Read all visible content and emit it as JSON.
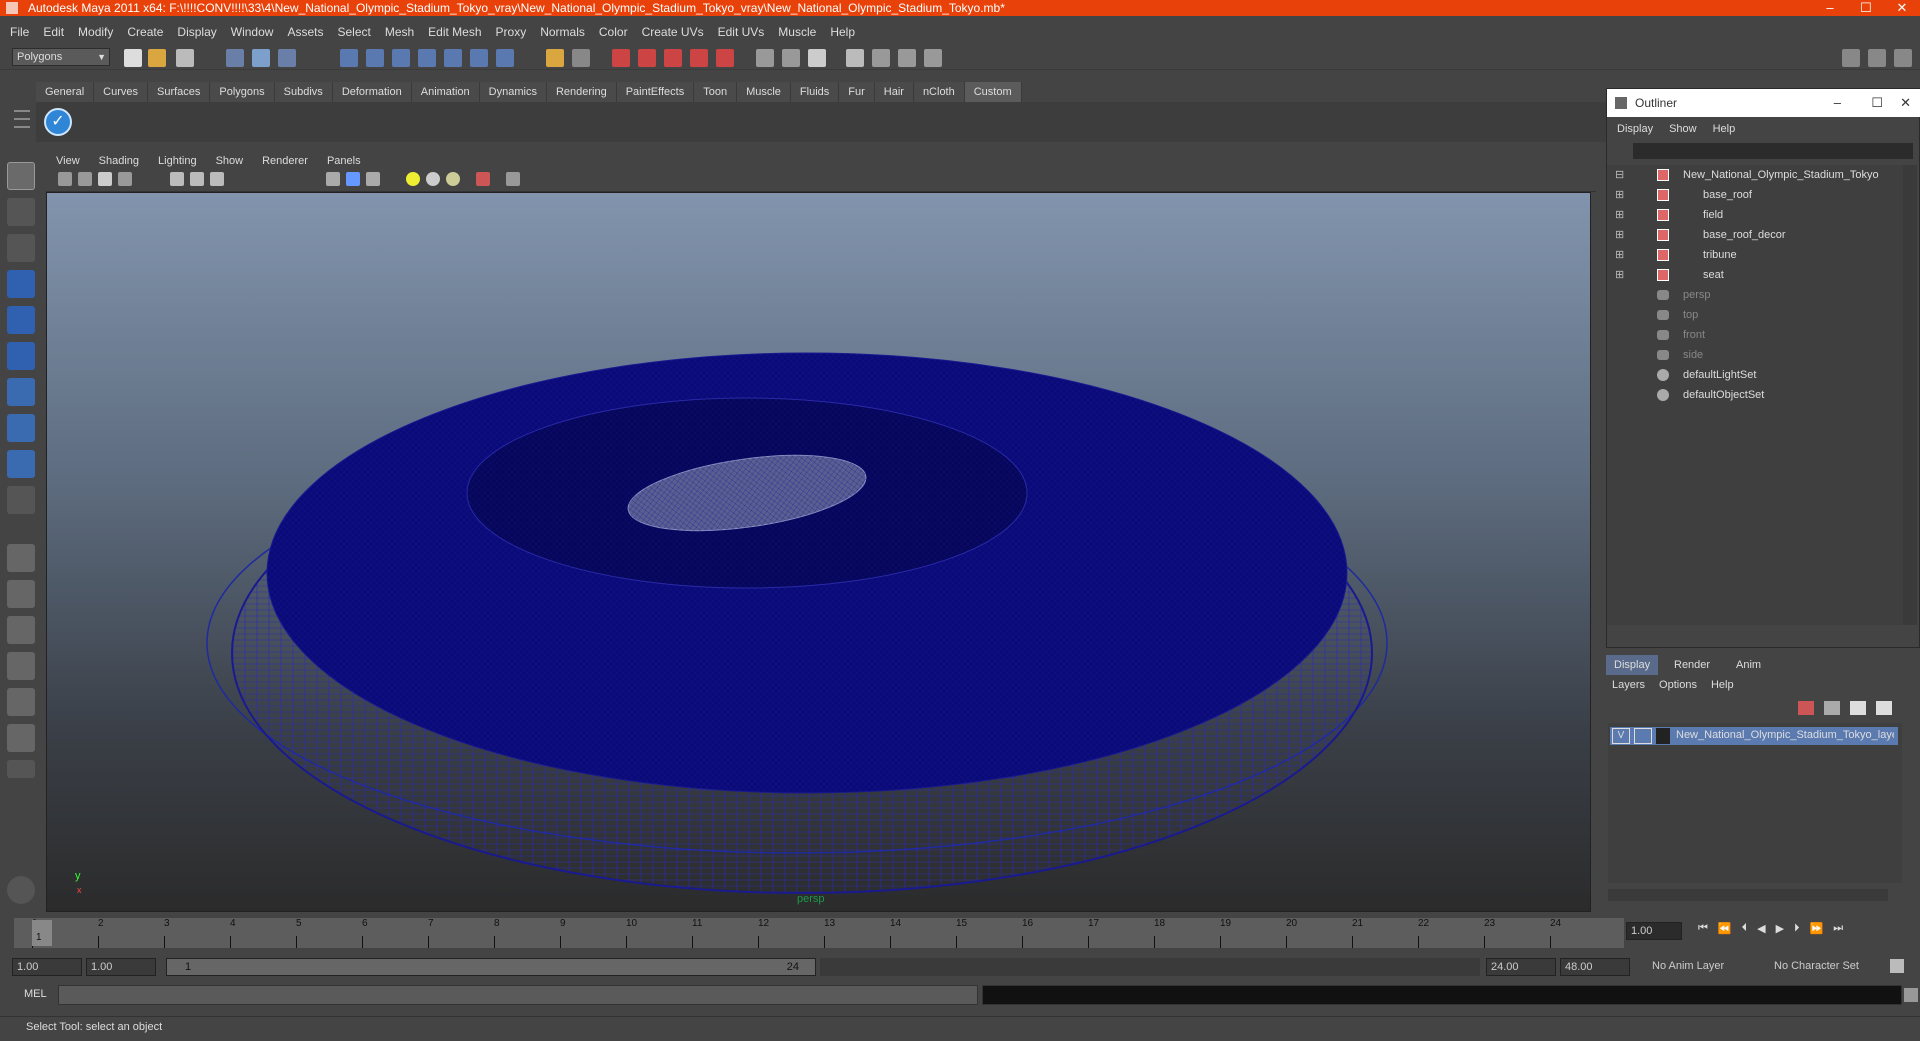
{
  "window": {
    "title": "Autodesk Maya 2011 x64: F:\\!!!!CONV!!!!\\33\\4\\New_National_Olympic_Stadium_Tokyo_vray\\New_National_Olympic_Stadium_Tokyo_vray\\New_National_Olympic_Stadium_Tokyo.mb*"
  },
  "menu": [
    "File",
    "Edit",
    "Modify",
    "Create",
    "Display",
    "Window",
    "Assets",
    "Select",
    "Mesh",
    "Edit Mesh",
    "Proxy",
    "Normals",
    "Color",
    "Create UVs",
    "Edit UVs",
    "Muscle",
    "Help"
  ],
  "mode_selector": "Polygons",
  "shelf_tabs": [
    "General",
    "Curves",
    "Surfaces",
    "Polygons",
    "Subdivs",
    "Deformation",
    "Animation",
    "Dynamics",
    "Rendering",
    "PaintEffects",
    "Toon",
    "Muscle",
    "Fluids",
    "Fur",
    "Hair",
    "nCloth",
    "Custom"
  ],
  "viewport": {
    "menu": [
      "View",
      "Shading",
      "Lighting",
      "Show",
      "Renderer",
      "Panels"
    ],
    "camera_label": "persp",
    "axis_y": "y",
    "axis_x": "x"
  },
  "outliner": {
    "title": "Outliner",
    "menu": [
      "Display",
      "Show",
      "Help"
    ],
    "items": [
      {
        "label": "New_National_Olympic_Stadium_Tokyo",
        "kind": "transform",
        "dim": false
      },
      {
        "label": "base_roof",
        "kind": "transform",
        "dim": false
      },
      {
        "label": "field",
        "kind": "transform",
        "dim": false
      },
      {
        "label": "base_roof_decor",
        "kind": "transform",
        "dim": false
      },
      {
        "label": "tribune",
        "kind": "transform",
        "dim": false
      },
      {
        "label": "seat",
        "kind": "transform",
        "dim": false
      },
      {
        "label": "persp",
        "kind": "camera",
        "dim": true
      },
      {
        "label": "top",
        "kind": "camera",
        "dim": true
      },
      {
        "label": "front",
        "kind": "camera",
        "dim": true
      },
      {
        "label": "side",
        "kind": "camera",
        "dim": true
      },
      {
        "label": "defaultLightSet",
        "kind": "set",
        "dim": false
      },
      {
        "label": "defaultObjectSet",
        "kind": "set",
        "dim": false
      }
    ]
  },
  "layer_editor": {
    "tabs": [
      "Display",
      "Render",
      "Anim"
    ],
    "menu": [
      "Layers",
      "Options",
      "Help"
    ],
    "layer": {
      "visible": "V",
      "name": "New_National_Olympic_Stadium_Tokyo_layer"
    }
  },
  "timeline": {
    "ticks": [
      "1",
      "2",
      "3",
      "4",
      "5",
      "6",
      "7",
      "8",
      "9",
      "10",
      "11",
      "12",
      "13",
      "14",
      "15",
      "16",
      "17",
      "18",
      "19",
      "20",
      "21",
      "22",
      "23",
      "24"
    ],
    "current_frame": "1",
    "current_field": "1.00"
  },
  "range": {
    "start": "1.00",
    "start2": "1.00",
    "slider_start": "1",
    "slider_end": "24",
    "end": "24.00",
    "end2": "48.00",
    "anim_layer": "No Anim Layer",
    "character_set": "No Character Set"
  },
  "mel": {
    "label": "MEL"
  },
  "status": "Select Tool: select an object"
}
